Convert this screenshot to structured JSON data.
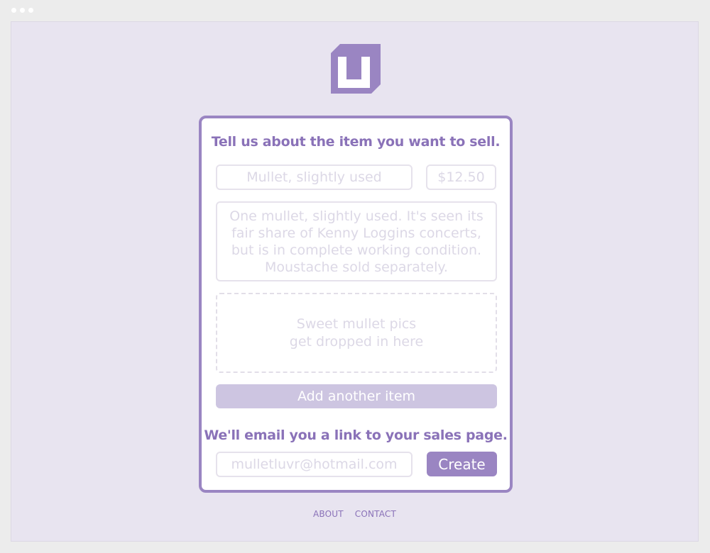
{
  "form": {
    "heading": "Tell us about the item you want to sell.",
    "title_placeholder": "Mullet, slightly used",
    "price_placeholder": "$12.50",
    "description_placeholder": "One mullet, slightly used. It's seen its\nfair share of Kenny Loggins concerts,\nbut is in complete working condition.\nMoustache sold separately.",
    "dropzone_text": "Sweet mullet pics\nget dropped in here",
    "add_item_label": "Add another item",
    "email_heading": "We'll email you a link to your sales page.",
    "email_placeholder": "mulletluvr@hotmail.com",
    "create_label": "Create"
  },
  "footer": {
    "links": [
      "ABOUT",
      "CONTACT"
    ]
  },
  "colors": {
    "accent": "#9a85c2",
    "background": "#e8e4f0",
    "button_light": "#cdc5e1"
  }
}
